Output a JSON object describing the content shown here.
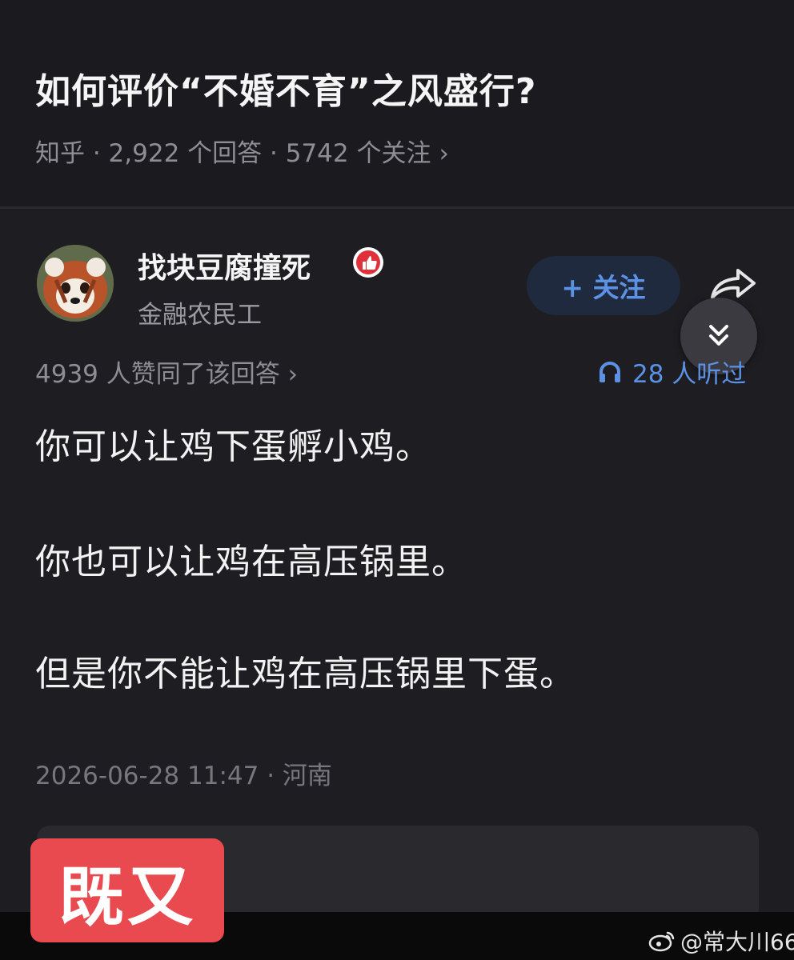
{
  "question": {
    "title": "如何评价“不婚不育”之风盛行?",
    "meta": "知乎 · 2,922 个回答 · 5742 个关注",
    "meta_chevron": "›"
  },
  "author": {
    "name": "找块豆腐撞死",
    "bio": "金融农民工",
    "avatar_icon": "red-panda-avatar",
    "badge_icon": "thumbs-up-badge-icon"
  },
  "actions": {
    "follow_label": "+ 关注",
    "share_icon": "share-arrow-icon",
    "collapse_icon": "double-chevron-down-icon"
  },
  "stats": {
    "likes": "4939 人赞同了该回答 ›",
    "listens": "28 人听过",
    "listen_icon": "headphones-icon"
  },
  "answer": {
    "paragraphs": [
      "你可以让鸡下蛋孵小鸡。",
      "你也可以让鸡在高压锅里。",
      "但是你不能让鸡在高压锅里下蛋。"
    ],
    "timestamp": "2026-06-28 11:47 · 河南"
  },
  "overlay": {
    "sticker_text": "既又",
    "watermark": "@常大川66",
    "watermark_icon": "weibo-icon"
  },
  "colors": {
    "background": "#1b1b1f",
    "accent_blue": "#5b92e6",
    "sticker_red": "#e94a4f"
  }
}
